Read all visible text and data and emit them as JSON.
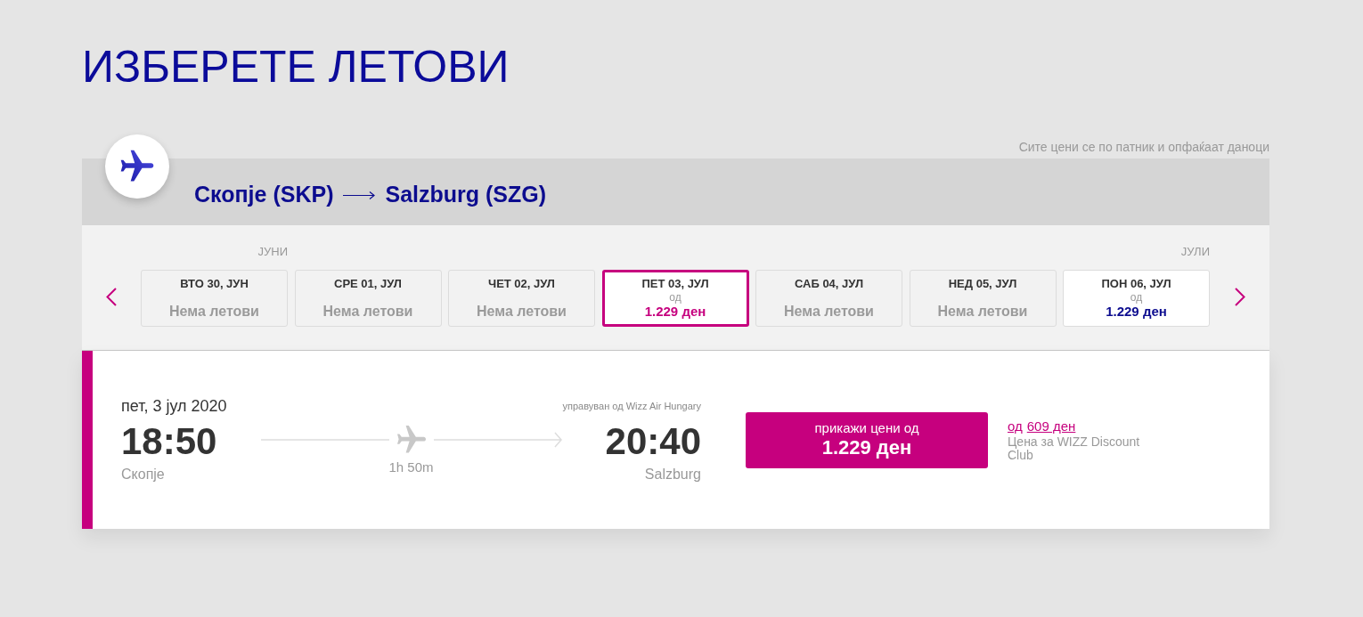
{
  "page": {
    "title": "ИЗБЕРЕТЕ ЛЕТОВИ",
    "price_note": "Сите цени се по патник и опфаќаат даноци"
  },
  "route": {
    "origin": "Скопје (SKP)",
    "destination": "Salzburg (SZG)"
  },
  "date_strip": {
    "dates": [
      {
        "kind": "no_flights",
        "month": "ЈУНИ",
        "label": "ВТО 30, ЈУН",
        "status": "Нема летови",
        "selected": false
      },
      {
        "kind": "no_flights",
        "label": "СРЕ 01, ЈУЛ",
        "status": "Нема летови",
        "selected": false
      },
      {
        "kind": "no_flights",
        "label": "ЧЕТ 02, ЈУЛ",
        "status": "Нема летови",
        "selected": false
      },
      {
        "kind": "priced",
        "label": "ПЕТ 03, ЈУЛ",
        "from": "од",
        "price": "1.229 ден",
        "selected": true
      },
      {
        "kind": "no_flights",
        "label": "САБ 04, ЈУЛ",
        "status": "Нема летови",
        "selected": false
      },
      {
        "kind": "no_flights",
        "label": "НЕД 05, ЈУЛ",
        "status": "Нема летови",
        "selected": false
      },
      {
        "kind": "priced",
        "month": "ЈУЛИ",
        "label": "ПОН 06, ЈУЛ",
        "from": "од",
        "price": "1.229 ден",
        "selected": false
      }
    ]
  },
  "flight": {
    "date": "пет, 3 јул 2020",
    "operator": "управуван од Wizz Air Hungary",
    "departure_time": "18:50",
    "departure_city": "Скопје",
    "duration": "1h 50m",
    "arrival_time": "20:40",
    "arrival_city": "Salzburg",
    "price_button": {
      "label": "прикажи цени од",
      "price": "1.229 ден"
    },
    "discount": {
      "prefix": "од",
      "price": "609 ден",
      "note": "Цена за WIZZ Discount Club"
    }
  }
}
